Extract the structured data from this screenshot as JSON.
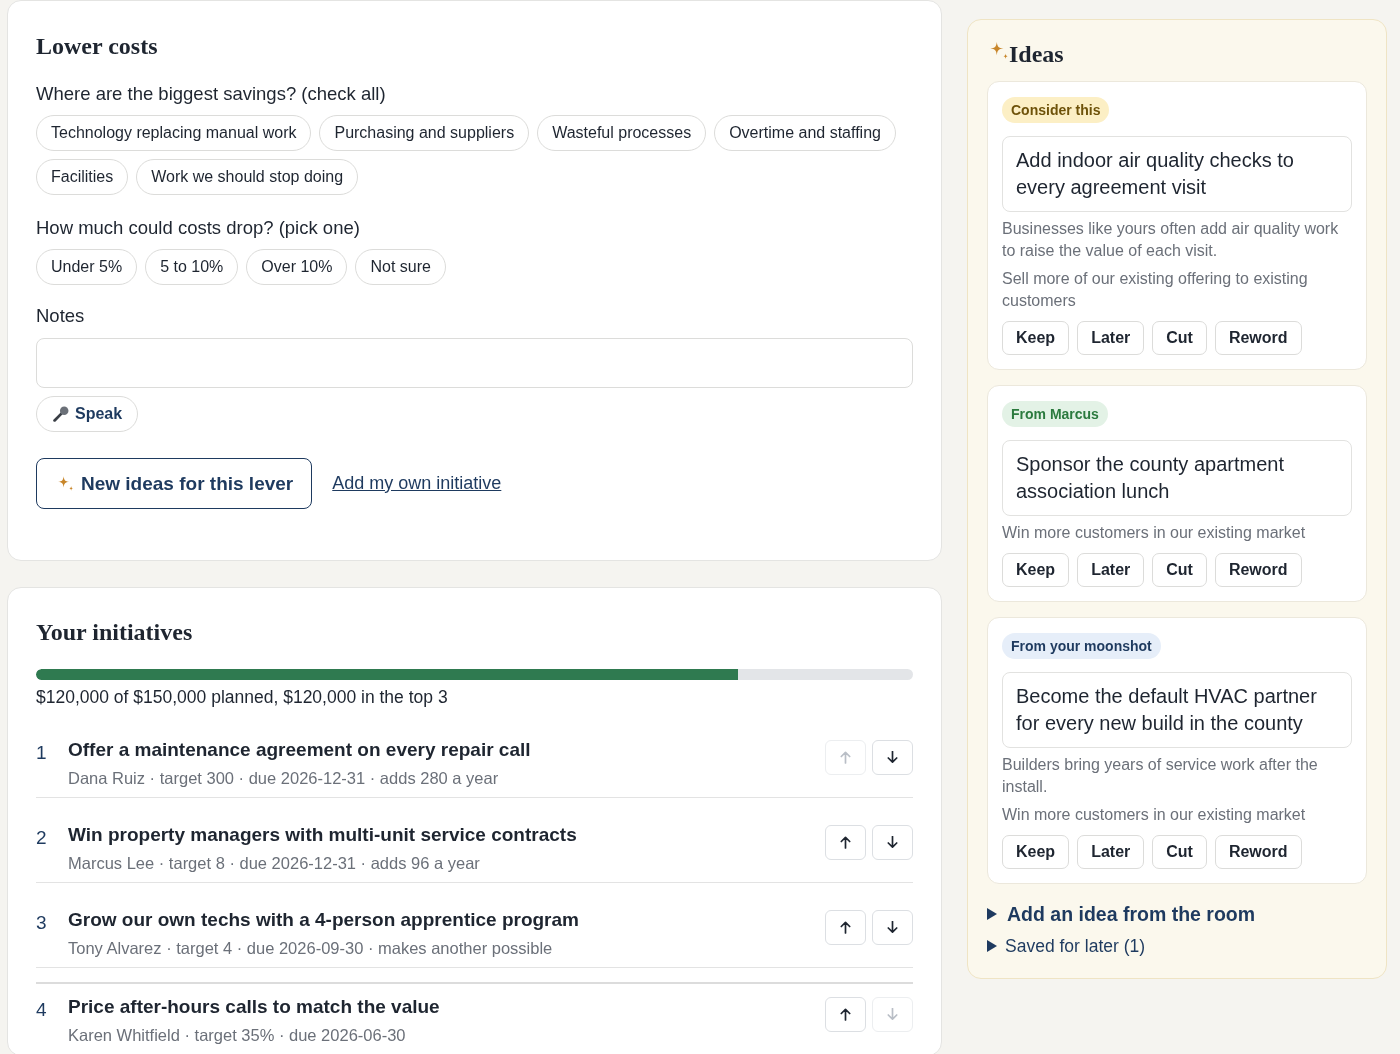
{
  "lever_card": {
    "title": "Lower costs",
    "questions": [
      {
        "label": "Where are the biggest savings? (check all)",
        "options": [
          {
            "label": "Technology replacing manual work",
            "selected": false
          },
          {
            "label": "Purchasing and suppliers",
            "selected": false
          },
          {
            "label": "Wasteful processes",
            "selected": false
          },
          {
            "label": "Overtime and staffing",
            "selected": false
          },
          {
            "label": "Facilities",
            "selected": false
          },
          {
            "label": "Work we should stop doing",
            "selected": false
          }
        ]
      },
      {
        "label": "How much could costs drop? (pick one)",
        "options": [
          {
            "label": "Under 5%",
            "selected": false
          },
          {
            "label": "5 to 10%",
            "selected": false
          },
          {
            "label": "Over 10%",
            "selected": false
          },
          {
            "label": "Not sure",
            "selected": false
          }
        ]
      }
    ],
    "notes": {
      "label": "Notes"
    },
    "speak_button": "Speak",
    "new_ideas_button": "New ideas for this lever",
    "add_link": "Add my own initiative"
  },
  "initiatives": {
    "title": "Your initiatives",
    "level": 0.8,
    "summary": "$120,000 of $150,000 planned, $120,000 in the top 3",
    "top_rows": [
      {
        "number": "1",
        "title": "Offer a maintenance agreement on every repair call",
        "meta": "Dana Ruiz · target 300 · due 2026-12-31 · adds 280 a year",
        "up_disabled": true,
        "down_disabled": false
      },
      {
        "number": "2",
        "title": "Win property managers with multi-unit service contracts",
        "meta": "Marcus Lee · target 8 · due 2026-12-31 · adds 96 a year",
        "up_disabled": false,
        "down_disabled": false
      },
      {
        "number": "3",
        "title": "Grow our own techs with a 4-person apprentice program",
        "meta": "Tony Alvarez · target 4 · due 2026-09-30 · makes another possible",
        "up_disabled": false,
        "down_disabled": false
      }
    ],
    "other_rows": [
      {
        "number": "4",
        "title": "Price after-hours calls to match the value",
        "meta": "Karen Whitfield · target 35% · due 2026-06-30",
        "up_disabled": false,
        "down_disabled": true
      }
    ]
  },
  "ideas": {
    "title": "Ideas",
    "cards": [
      {
        "tag": {
          "text": "Consider this",
          "kind": "suggestion"
        },
        "title": "Add indoor air quality checks to every agreement visit",
        "why": "Businesses like yours often add air quality work to raise the value of each visit.",
        "category": "Sell more of our existing offering to existing customers",
        "actions": [
          "Keep",
          "Later",
          "Cut",
          "Reword"
        ]
      },
      {
        "tag": {
          "text": "From Marcus",
          "kind": "teammate"
        },
        "title": "Sponsor the county apartment association lunch",
        "category": "Win more customers in our existing market",
        "actions": [
          "Keep",
          "Later",
          "Cut",
          "Reword"
        ]
      },
      {
        "tag": {
          "text": "From your moonshot",
          "kind": "moonshot"
        },
        "title": "Become the default HVAC partner for every new build in the county",
        "why": "Builders bring years of service work after the install.",
        "category": "Win more customers in our existing market",
        "actions": [
          "Keep",
          "Later",
          "Cut",
          "Reword"
        ]
      }
    ],
    "sections": [
      {
        "label": "Add an idea from the room",
        "kind": "primary",
        "expanded": false
      },
      {
        "label": "Saved for later (1)",
        "kind": "secondary",
        "expanded": false
      }
    ]
  }
}
